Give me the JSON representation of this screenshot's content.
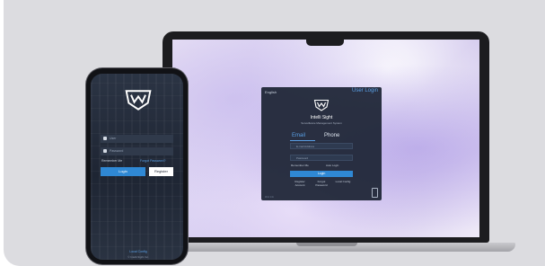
{
  "laptop": {
    "language": "English",
    "user_login": "User Login",
    "brand": "Intelli Sight",
    "subtitle": "Surveillance Management System",
    "tabs": {
      "email": "Email",
      "phone": "Phone"
    },
    "email_placeholder": "E-mail Address",
    "password_placeholder": "Password",
    "remember_me": "Remember Me",
    "auto_login": "Auto Login",
    "login_button": "Login",
    "links": [
      "Register Account",
      "Forgot Password",
      "Local Config"
    ],
    "footer": "Web Info"
  },
  "phone": {
    "user_placeholder": "User",
    "password_placeholder": "Password",
    "remember_me": "Remember Me",
    "forgot_password": "Forgot Password?",
    "login_button": "Login",
    "register_button": "Register",
    "footer_link": "Local Config",
    "copyright": "© Intelli-Sight Inc."
  },
  "colors": {
    "accent": "#2f88d4",
    "card": "#1c2434",
    "link": "#5aa0e6"
  }
}
